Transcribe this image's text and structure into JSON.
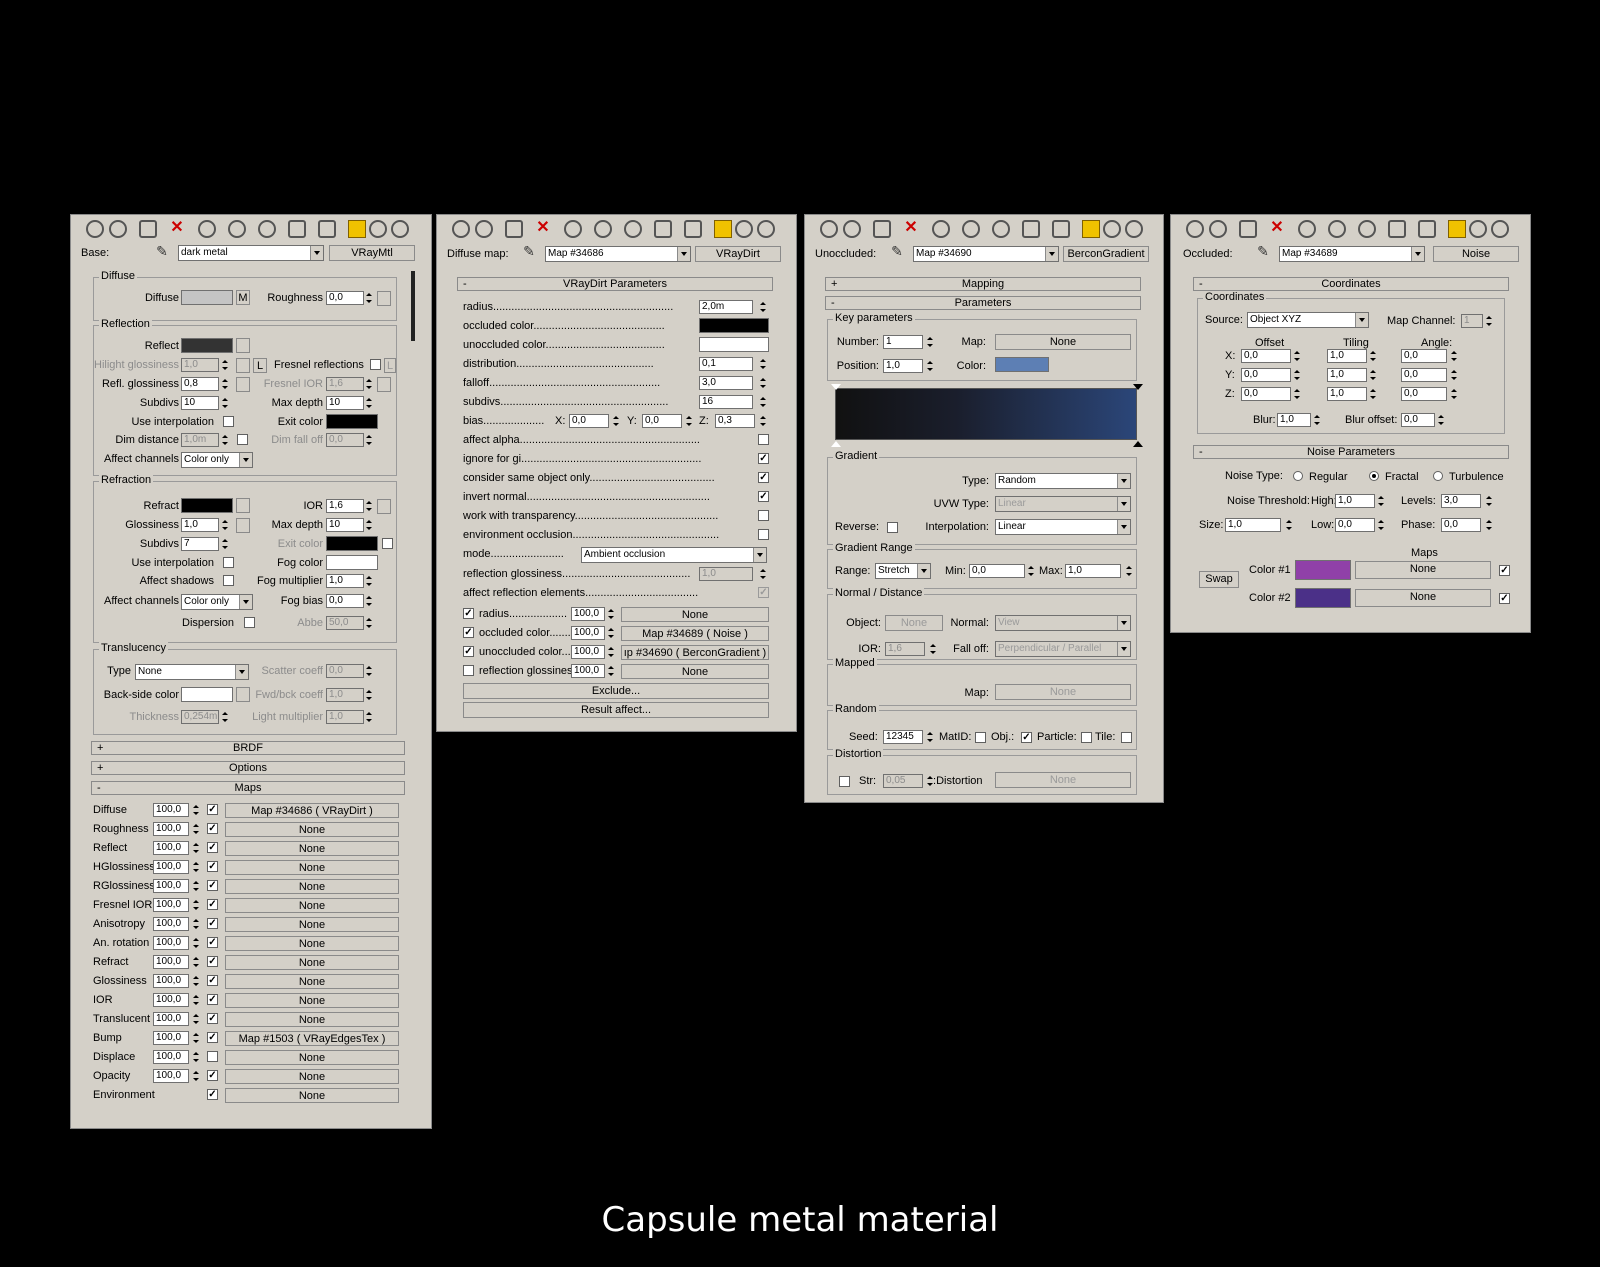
{
  "caption": "Capsule metal material",
  "colors": {
    "diffuse": "#c4c4c4",
    "reflect": "#333333",
    "exit_color": "#000000",
    "refract": "#000000",
    "fog_color": "#ffffff",
    "back_side": "#ffffff",
    "occluded": "#000000",
    "unoccluded": "#ffffff",
    "key_color": "#5d7fb4",
    "gradient_start": "#111111",
    "gradient_end": "#2b4679",
    "noise_color1": "#9040a8",
    "noise_color2": "#4b3088"
  },
  "p1": {
    "base_label": "Base:",
    "base_value": "dark metal",
    "type_btn": "VRayMtl",
    "diffuse": {
      "group": "Diffuse",
      "diffuse_label": "Diffuse",
      "m_btn": "M",
      "roughness_label": "Roughness",
      "roughness": "0,0"
    },
    "reflection": {
      "group": "Reflection",
      "reflect_label": "Reflect",
      "hilight_label": "Hilight glossiness",
      "hilight": "1,0",
      "l_btn": "L",
      "fresnel_label": "Fresnel reflections",
      "refl_gloss_label": "Refl. glossiness",
      "refl_gloss": "0,8",
      "fresnel_ior_label": "Fresnel IOR",
      "fresnel_ior": "1,6",
      "subdivs_label": "Subdivs",
      "subdivs": "10",
      "max_depth_label": "Max depth",
      "max_depth": "10",
      "use_interp_label": "Use interpolation",
      "exit_label": "Exit color",
      "dim_dist_label": "Dim distance",
      "dim_dist": "1,0m",
      "dim_falloff_label": "Dim fall off",
      "dim_falloff": "0,0",
      "affect_label": "Affect channels",
      "affect_value": "Color only"
    },
    "refraction": {
      "group": "Refraction",
      "refract_label": "Refract",
      "ior_label": "IOR",
      "ior": "1,6",
      "gloss_label": "Glossiness",
      "gloss": "1,0",
      "max_depth_label": "Max depth",
      "max_depth": "10",
      "subdivs_label": "Subdivs",
      "subdivs": "7",
      "exit_label": "Exit color",
      "use_interp_label": "Use interpolation",
      "fog_color_label": "Fog color",
      "affect_shadows_label": "Affect shadows",
      "fog_mult_label": "Fog multiplier",
      "fog_mult": "1,0",
      "affect_label": "Affect channels",
      "affect_value": "Color only",
      "fog_bias_label": "Fog bias",
      "fog_bias": "0,0",
      "dispersion_label": "Dispersion",
      "abbe_label": "Abbe",
      "abbe": "50,0"
    },
    "translucency": {
      "group": "Translucency",
      "type_label": "Type",
      "type_value": "None",
      "scatter_label": "Scatter coeff",
      "scatter": "0,0",
      "back_label": "Back-side color",
      "fwd_label": "Fwd/bck coeff",
      "fwd": "1,0",
      "thick_label": "Thickness",
      "thick": "0,254m",
      "light_label": "Light multiplier",
      "light": "1,0"
    },
    "rollouts": {
      "brdf": "BRDF",
      "options": "Options",
      "maps": "Maps",
      "plus": "+",
      "minus": "-"
    },
    "maps": [
      {
        "name": "Diffuse",
        "amount": "100,0",
        "map": "Map #34686  ( VRayDirt )"
      },
      {
        "name": "Roughness",
        "amount": "100,0",
        "map": "None"
      },
      {
        "name": "Reflect",
        "amount": "100,0",
        "map": "None"
      },
      {
        "name": "HGlossiness",
        "amount": "100,0",
        "map": "None"
      },
      {
        "name": "RGlossiness",
        "amount": "100,0",
        "map": "None"
      },
      {
        "name": "Fresnel IOR",
        "amount": "100,0",
        "map": "None"
      },
      {
        "name": "Anisotropy",
        "amount": "100,0",
        "map": "None"
      },
      {
        "name": "An. rotation",
        "amount": "100,0",
        "map": "None"
      },
      {
        "name": "Refract",
        "amount": "100,0",
        "map": "None"
      },
      {
        "name": "Glossiness",
        "amount": "100,0",
        "map": "None"
      },
      {
        "name": "IOR",
        "amount": "100,0",
        "map": "None"
      },
      {
        "name": "Translucent",
        "amount": "100,0",
        "map": "None"
      },
      {
        "name": "Bump",
        "amount": "100,0",
        "map": "Map #1503  ( VRayEdgesTex )"
      },
      {
        "name": "Displace",
        "amount": "100,0",
        "map": "None"
      },
      {
        "name": "Opacity",
        "amount": "100,0",
        "map": "None"
      },
      {
        "name": "Environment",
        "amount": "",
        "map": "None"
      }
    ],
    "check": "✓"
  },
  "p2": {
    "label": "Diffuse map:",
    "map_value": "Map #34686",
    "type_btn": "VRayDirt",
    "rollout": "VRayDirt Parameters",
    "radius_label": "radius...........................................................",
    "radius": "2,0m",
    "occluded_label": "occluded color...........................................",
    "unoccluded_label": "unoccluded color.......................................",
    "distribution_label": "distribution.............................................",
    "distribution": "0,1",
    "falloff_label": "falloff........................................................",
    "falloff": "3,0",
    "subdivs_label": "subdivs.......................................................",
    "subdivs": "16",
    "bias_label": "bias....................",
    "x_label": "X:",
    "bias_x": "0,0",
    "y_label": "Y:",
    "bias_y": "0,0",
    "z_label": "Z:",
    "bias_z": "0,3",
    "checks": [
      {
        "label": "affect alpha...........................................................",
        "on": ""
      },
      {
        "label": "ignore for gi...........................................................",
        "on": "✓"
      },
      {
        "label": "consider same object only.........................................",
        "on": "✓"
      },
      {
        "label": "invert normal............................................................",
        "on": "✓"
      },
      {
        "label": "work with transparency...............................................",
        "on": ""
      },
      {
        "label": "environment occlusion................................................",
        "on": ""
      }
    ],
    "mode_label": "mode........................",
    "mode_value": "Ambient occlusion",
    "refl_gloss_label": "reflection glossiness..........................................",
    "refl_gloss": "1,0",
    "affect_refl_label": "affect reflection elements.....................................",
    "map_rows": [
      {
        "label": "radius...................",
        "amount": "100,0",
        "map": "None",
        "on": "✓"
      },
      {
        "label": "occluded color.......",
        "amount": "100,0",
        "map": "Map #34689  ( Noise )",
        "on": "✓"
      },
      {
        "label": "unoccluded color...",
        "amount": "100,0",
        "map": "ıp #34690  ( BerconGradient )",
        "on": "✓"
      },
      {
        "label": "reflection glossiness",
        "amount": "100,0",
        "map": "None",
        "on": ""
      }
    ],
    "exclude_btn": "Exclude...",
    "result_btn": "Result affect..."
  },
  "p3": {
    "label": "Unoccluded:",
    "map_value": "Map #34690",
    "type_btn": "BerconGradient",
    "mapping": "Mapping",
    "parameters": "Parameters",
    "key": {
      "group": "Key parameters",
      "number_label": "Number:",
      "number": "1",
      "map_label": "Map:",
      "map_btn": "None",
      "position_label": "Position:",
      "position": "1,0",
      "color_label": "Color:"
    },
    "gradient": {
      "group": "Gradient",
      "type_label": "Type:",
      "type_value": "Random",
      "uvw_label": "UVW Type:",
      "uvw_value": "Linear",
      "reverse_label": "Reverse:",
      "interp_label": "Interpolation:",
      "interp_value": "Linear"
    },
    "range": {
      "group": "Gradient Range",
      "range_label": "Range:",
      "range_value": "Stretch",
      "min_label": "Min:",
      "min": "0,0",
      "max_label": "Max:",
      "max": "1,0"
    },
    "normal": {
      "group": "Normal / Distance",
      "object_label": "Object:",
      "object_btn": "None",
      "normal_label": "Normal:",
      "normal_value": "View",
      "ior_label": "IOR:",
      "ior": "1,6",
      "falloff_label": "Fall off:",
      "falloff_value": "Perpendicular / Parallel"
    },
    "mapped": {
      "group": "Mapped",
      "map_label": "Map:",
      "map_btn": "None"
    },
    "random": {
      "group": "Random",
      "seed_label": "Seed:",
      "seed": "12345",
      "matid_label": "MatID:",
      "obj_label": "Obj.:",
      "particle_label": "Particle:",
      "tile_label": "Tile:",
      "check": "✓"
    },
    "distortion": {
      "group": "Distortion",
      "str_label": "Str:",
      "str": "0,05",
      "dist_label": "Distortion:",
      "dist_btn": "None"
    }
  },
  "p4": {
    "label": "Occluded:",
    "map_value": "Map #34689",
    "type_btn": "Noise",
    "coords": "Coordinates",
    "coord_group": "Coordinates",
    "source_label": "Source:",
    "source_value": "Object XYZ",
    "channel_label": "Map Channel:",
    "channel": "1",
    "offset_label": "Offset",
    "tiling_label": "Tiling",
    "angle_label": "Angle:",
    "rows": [
      {
        "axis": "X:",
        "offset": "0,0",
        "tiling": "1,0",
        "angle": "0,0"
      },
      {
        "axis": "Y:",
        "offset": "0,0",
        "tiling": "1,0",
        "angle": "0,0"
      },
      {
        "axis": "Z:",
        "offset": "0,0",
        "tiling": "1,0",
        "angle": "0,0"
      }
    ],
    "blur_label": "Blur:",
    "blur": "1,0",
    "blur_off_label": "Blur offset:",
    "blur_off": "0,0",
    "noise_params": "Noise Parameters",
    "noise_type_label": "Noise Type:",
    "regular": "Regular",
    "fractal": "Fractal",
    "turbulence": "Turbulence",
    "threshold_label": "Noise Threshold:",
    "high_label": "High:",
    "high": "1,0",
    "levels_label": "Levels:",
    "levels": "3,0",
    "size_label": "Size:",
    "size": "1,0",
    "low_label": "Low:",
    "low": "0,0",
    "phase_label": "Phase:",
    "phase": "0,0",
    "maps_label": "Maps",
    "swap_btn": "Swap",
    "color1_label": "Color #1",
    "color2_label": "Color #2",
    "map_none": "None",
    "check": "✓"
  }
}
